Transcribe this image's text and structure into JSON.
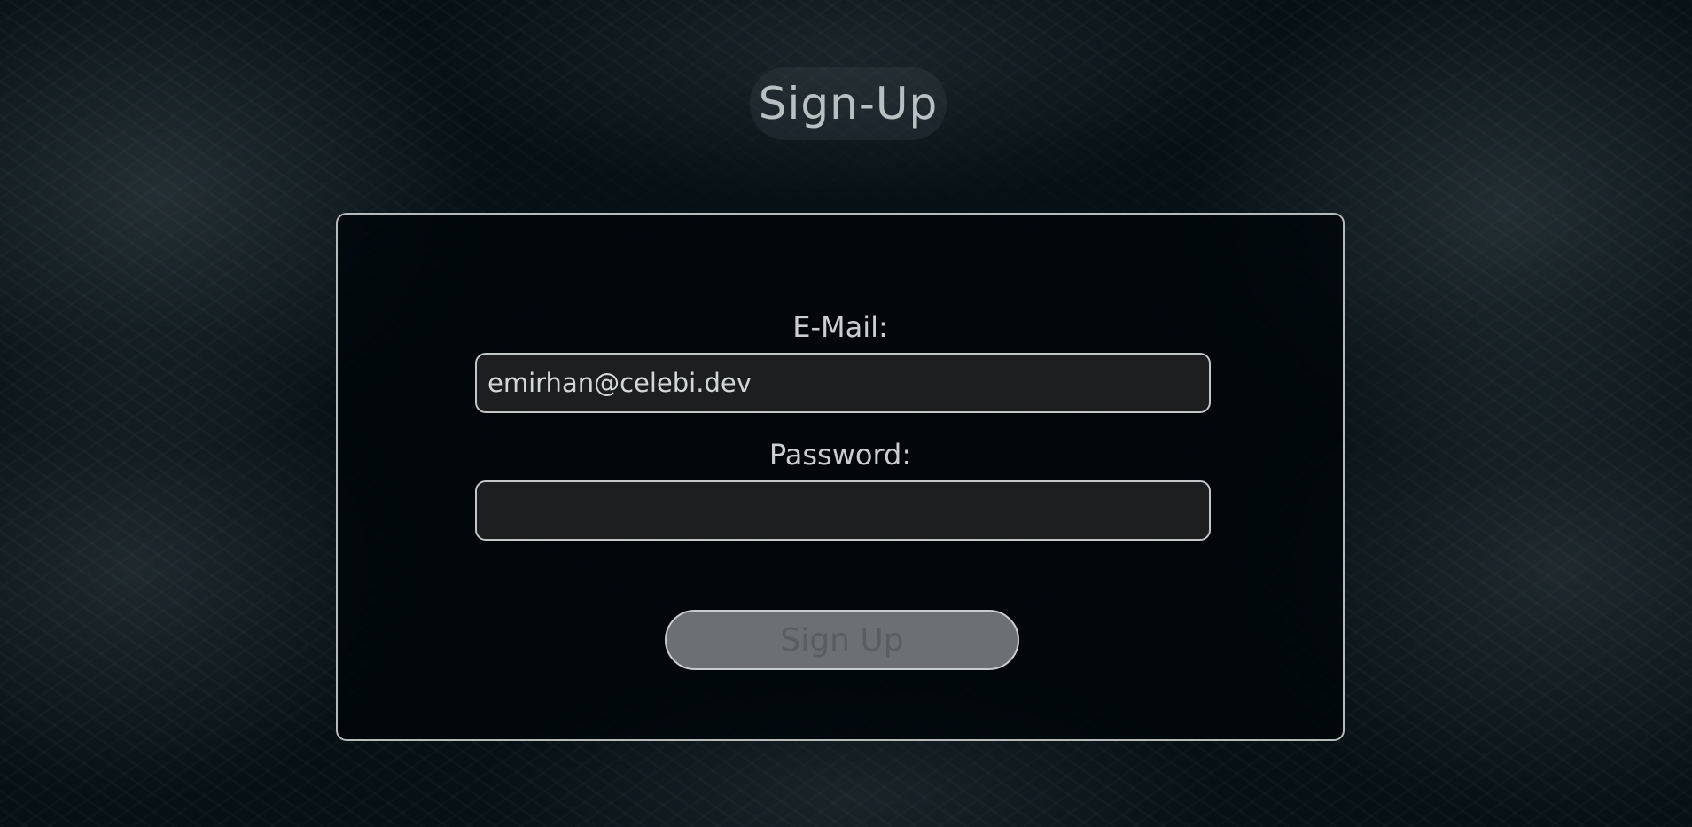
{
  "page": {
    "title": "Sign-Up"
  },
  "form": {
    "email_label": "E-Mail:",
    "email_value": "emirhan@celebi.dev",
    "password_label": "Password:",
    "password_value": "",
    "submit_label": "Sign Up"
  },
  "colors": {
    "background": "#061015",
    "card_border": "#b6babb",
    "text": "#c9cfd0",
    "button_fill": "#6c7073"
  }
}
